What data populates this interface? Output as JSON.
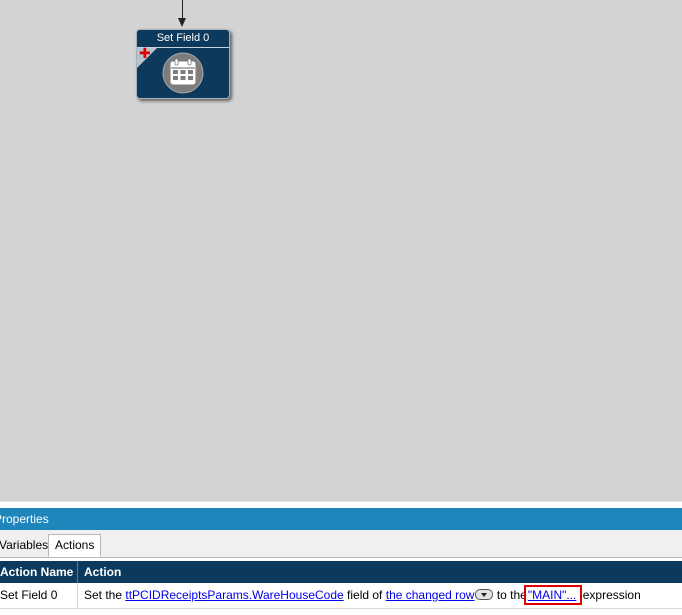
{
  "canvas": {
    "node": {
      "title": "Set Field 0",
      "icon": "calendar-icon",
      "badge_icon": "plus-icon",
      "colors": {
        "background": "#0d3a5c",
        "badge": "#e00000"
      }
    }
  },
  "properties": {
    "header": "Properties",
    "tabs": [
      {
        "label": "Variables",
        "active": false
      },
      {
        "label": "Actions",
        "active": true
      }
    ],
    "table": {
      "columns": [
        "Action Name",
        "Action"
      ],
      "rows": [
        {
          "name": "Set Field 0",
          "action": {
            "prefix": "Set the",
            "field_link": "ttPCIDReceiptsParams.WareHouseCode",
            "middle": "field of",
            "row_link": "the changed row",
            "to": "to the",
            "value_link": "\"MAIN\"...",
            "suffix": "expression"
          }
        }
      ]
    },
    "colors": {
      "header_bar": "#1e86bb",
      "table_header": "#0d3a5c",
      "highlight": "#e00000"
    }
  }
}
